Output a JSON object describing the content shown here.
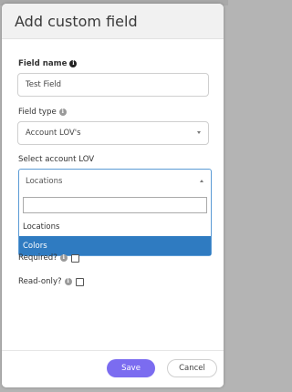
{
  "modal": {
    "title": "Add custom field"
  },
  "form": {
    "field_name": {
      "label": "Field name",
      "value": "Test Field"
    },
    "field_type": {
      "label": "Field type",
      "value": "Account LOV's"
    },
    "account_lov": {
      "label": "Select account LOV",
      "selected": "Locations",
      "search_value": "",
      "options": [
        "Locations",
        "Colors"
      ],
      "highlighted_index": 1
    },
    "required": {
      "label": "Required?",
      "checked": false
    },
    "read_only": {
      "label": "Read-only?",
      "checked": false
    }
  },
  "footer": {
    "save_label": "Save",
    "cancel_label": "Cancel"
  },
  "colors": {
    "accent": "#7b6cf0",
    "highlight": "#2f7bc1"
  }
}
